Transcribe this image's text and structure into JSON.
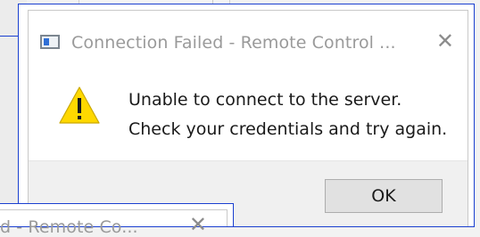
{
  "dialog": {
    "title": "Connection Failed - Remote Control ...",
    "close_glyph": "✕",
    "message_line1": "Unable to connect to the server.",
    "message_line2": "Check your credentials and try again.",
    "ok_label": "OK",
    "icon": "warning-icon",
    "app_icon": "window-icon"
  },
  "background_dialog": {
    "title_fragment": "d - Remote Co...",
    "close_glyph": "✕"
  },
  "colors": {
    "focus_outline": "#1a3fd0",
    "warning_fill": "#ffd800",
    "button_face": "#e1e1e1",
    "footer": "#f0f0f0"
  }
}
